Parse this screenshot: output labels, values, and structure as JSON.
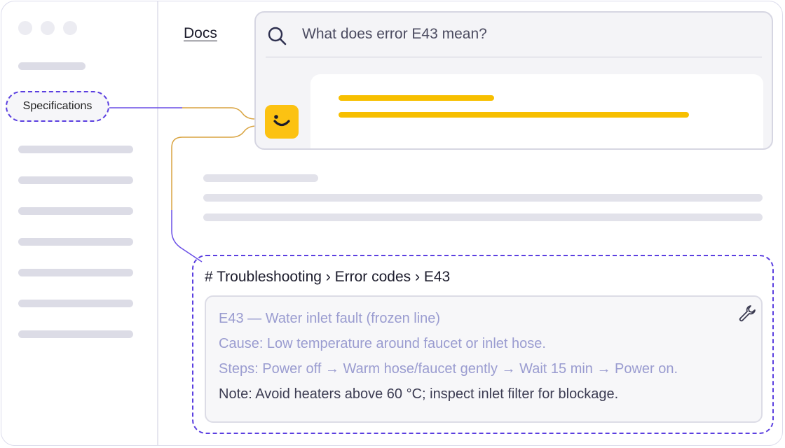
{
  "sidebar": {
    "highlighted_item": "Specifications"
  },
  "header": {
    "docs_link": "Docs"
  },
  "search": {
    "query": "What does error E43 mean?",
    "icon": "search-icon"
  },
  "assistant": {
    "icon": "smiley-bot-icon",
    "accent_color": "#fcc212"
  },
  "result": {
    "breadcrumb": "# Troubleshooting › Error codes › E43",
    "tool_icon": "wrench-icon",
    "lines": [
      "E43 — Water inlet fault (frozen line)",
      "Cause: Low temperature around faucet or inlet hose.",
      "Steps: Power off → Warm hose/faucet gently → Wait 15 min → Power on.",
      "Note: Avoid heaters above 60 °C; inspect inlet filter for blockage."
    ]
  },
  "colors": {
    "highlight_border": "#5b3fe0",
    "connector_orange": "#d9a441",
    "placeholder_bar": "#dcdce6"
  }
}
